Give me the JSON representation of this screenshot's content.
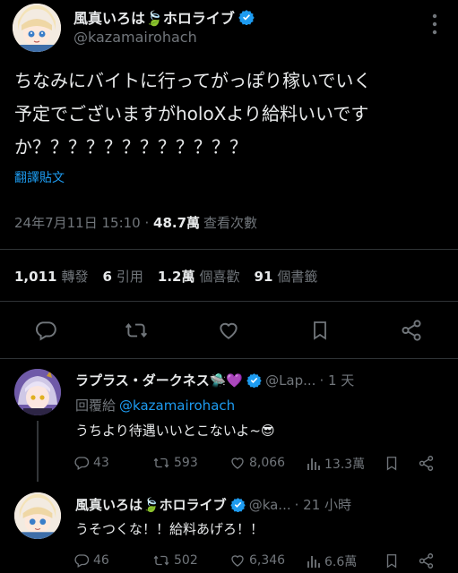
{
  "main_tweet": {
    "display_name": "風真いろは🍃ホロライブ",
    "handle": "@kazamairohach",
    "text_line1": "ちなみにバイトに行ってがっぽり稼いでいく",
    "text_line2": "予定でございますがholoXより給料いいです",
    "text_line3": "か？？？？？？？？？？？？",
    "translate_label": "翻譯貼文",
    "timestamp": "24年7月11日 15:10",
    "views_count": "48.7萬",
    "views_label": "查看次數",
    "retweets_count": "1,011",
    "retweets_label": "轉發",
    "quotes_count": "6",
    "quotes_label": "引用",
    "likes_count": "1.2萬",
    "likes_label": "個喜歡",
    "bookmarks_count": "91",
    "bookmarks_label": "個書籤"
  },
  "reply1": {
    "display_name": "ラプラス・ダークネス🛸💜",
    "handle": "@Lap...",
    "time": "· 1 天",
    "replying_label": "回覆給",
    "replying_to": "@kazamairohach",
    "text": "うちより待遇いいとこないよ~😎",
    "replies": "43",
    "retweets": "593",
    "likes": "8,066",
    "views": "13.3萬"
  },
  "reply2": {
    "display_name": "風真いろは🍃ホロライブ",
    "handle": "@ka...",
    "time": "· 21 小時",
    "text": "うそつくな！！給料あげろ！！",
    "replies": "46",
    "retweets": "502",
    "likes": "6,346",
    "views": "6.6萬"
  },
  "colors": {
    "background": "#000000",
    "text": "#e7e9ea",
    "muted": "#71767b",
    "link": "#1d9bf0",
    "verified": "#1d9bf0"
  }
}
